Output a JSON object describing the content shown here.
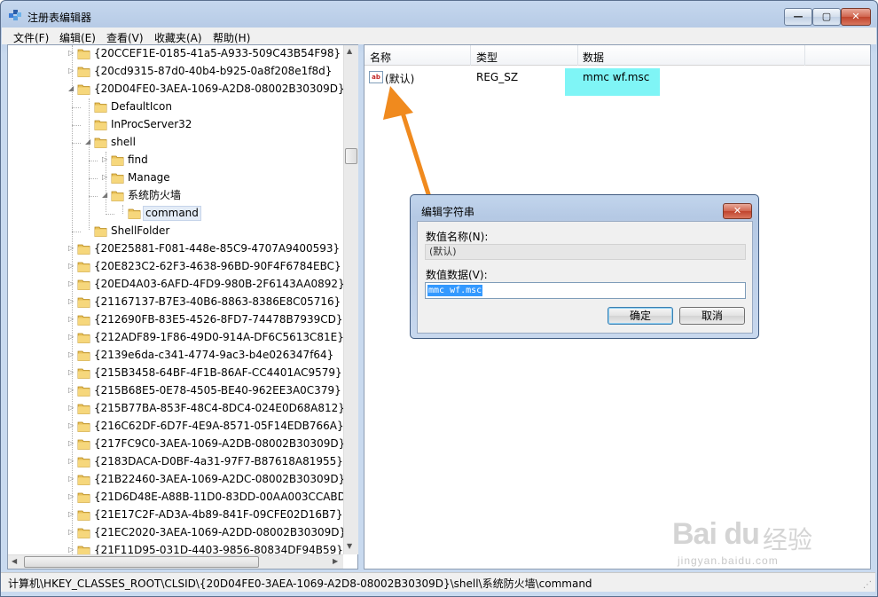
{
  "window": {
    "title": "注册表编辑器",
    "min_glyph": "—",
    "max_glyph": "▢",
    "close_glyph": "✕"
  },
  "menu": [
    "文件(F)",
    "编辑(E)",
    "查看(V)",
    "收藏夹(A)",
    "帮助(H)"
  ],
  "tree": {
    "items": [
      {
        "label": "{20CCEF1E-0185-41a5-A933-509C43B54F98}",
        "level": 0,
        "expander": "collapsed"
      },
      {
        "label": "{20cd9315-87d0-40b4-b925-0a8f208e1f8d}",
        "level": 0,
        "expander": "collapsed"
      },
      {
        "label": "{20D04FE0-3AEA-1069-A2D8-08002B30309D}",
        "level": 0,
        "expander": "expanded"
      },
      {
        "label": "DefaultIcon",
        "level": 1,
        "expander": "none"
      },
      {
        "label": "InProcServer32",
        "level": 1,
        "expander": "none"
      },
      {
        "label": "shell",
        "level": 1,
        "expander": "expanded"
      },
      {
        "label": "find",
        "level": 2,
        "expander": "collapsed"
      },
      {
        "label": "Manage",
        "level": 2,
        "expander": "collapsed"
      },
      {
        "label": "系统防火墙",
        "level": 2,
        "expander": "expanded"
      },
      {
        "label": "command",
        "level": 3,
        "expander": "none",
        "selected": true
      },
      {
        "label": "ShellFolder",
        "level": 1,
        "expander": "none"
      },
      {
        "label": "{20E25881-F081-448e-85C9-4707A9400593}",
        "level": 0,
        "expander": "collapsed"
      },
      {
        "label": "{20E823C2-62F3-4638-96BD-90F4F6784EBC}",
        "level": 0,
        "expander": "collapsed"
      },
      {
        "label": "{20ED4A03-6AFD-4FD9-980B-2F6143AA0892}",
        "level": 0,
        "expander": "collapsed"
      },
      {
        "label": "{21167137-B7E3-40B6-8863-8386E8C05716}",
        "level": 0,
        "expander": "collapsed"
      },
      {
        "label": "{212690FB-83E5-4526-8FD7-74478B7939CD}",
        "level": 0,
        "expander": "collapsed"
      },
      {
        "label": "{212ADF89-1F86-49D0-914A-DF6C5613C81E}",
        "level": 0,
        "expander": "collapsed"
      },
      {
        "label": "{2139e6da-c341-4774-9ac3-b4e026347f64}",
        "level": 0,
        "expander": "collapsed"
      },
      {
        "label": "{215B3458-64BF-4F1B-86AF-CC4401AC9579}",
        "level": 0,
        "expander": "collapsed"
      },
      {
        "label": "{215B68E5-0E78-4505-BE40-962EE3A0C379}",
        "level": 0,
        "expander": "collapsed"
      },
      {
        "label": "{215B77BA-853F-48C4-8DC4-024E0D68A812}",
        "level": 0,
        "expander": "collapsed"
      },
      {
        "label": "{216C62DF-6D7F-4E9A-8571-05F14EDB766A}",
        "level": 0,
        "expander": "collapsed"
      },
      {
        "label": "{217FC9C0-3AEA-1069-A2DB-08002B30309D}",
        "level": 0,
        "expander": "collapsed"
      },
      {
        "label": "{2183DACA-D0BF-4a31-97F7-B87618A81955}",
        "level": 0,
        "expander": "collapsed"
      },
      {
        "label": "{21B22460-3AEA-1069-A2DC-08002B30309D}",
        "level": 0,
        "expander": "collapsed"
      },
      {
        "label": "{21D6D48E-A88B-11D0-83DD-00AA003CCABD}",
        "level": 0,
        "expander": "collapsed"
      },
      {
        "label": "{21E17C2F-AD3A-4b89-841F-09CFE02D16B7}",
        "level": 0,
        "expander": "collapsed"
      },
      {
        "label": "{21EC2020-3AEA-1069-A2DD-08002B30309D}",
        "level": 0,
        "expander": "collapsed"
      },
      {
        "label": "{21F11D95-031D-4403-9856-80834DF94B59}",
        "level": 0,
        "expander": "collapsed"
      }
    ]
  },
  "list": {
    "columns": [
      "名称",
      "类型",
      "数据"
    ],
    "rows": [
      {
        "icon": "ab",
        "name": "(默认)",
        "type": "REG_SZ",
        "data": "mmc wf.msc"
      }
    ],
    "highlight_color": "#7ff5f6"
  },
  "dialog": {
    "title": "编辑字符串",
    "close_glyph": "✕",
    "name_label": "数值名称(N):",
    "name_value": "(默认)",
    "data_label": "数值数据(V):",
    "data_value": "mmc wf.msc",
    "ok_label": "确定",
    "cancel_label": "取消"
  },
  "statusbar": {
    "path": "计算机\\HKEY_CLASSES_ROOT\\CLSID\\{20D04FE0-3AEA-1069-A2D8-08002B30309D}\\shell\\系统防火墙\\command"
  },
  "annotation": {
    "arrow_color": "#f08a1e"
  },
  "watermark": {
    "brand": "Bai du",
    "sub": "经验",
    "url": "jingyan.baidu.com"
  }
}
